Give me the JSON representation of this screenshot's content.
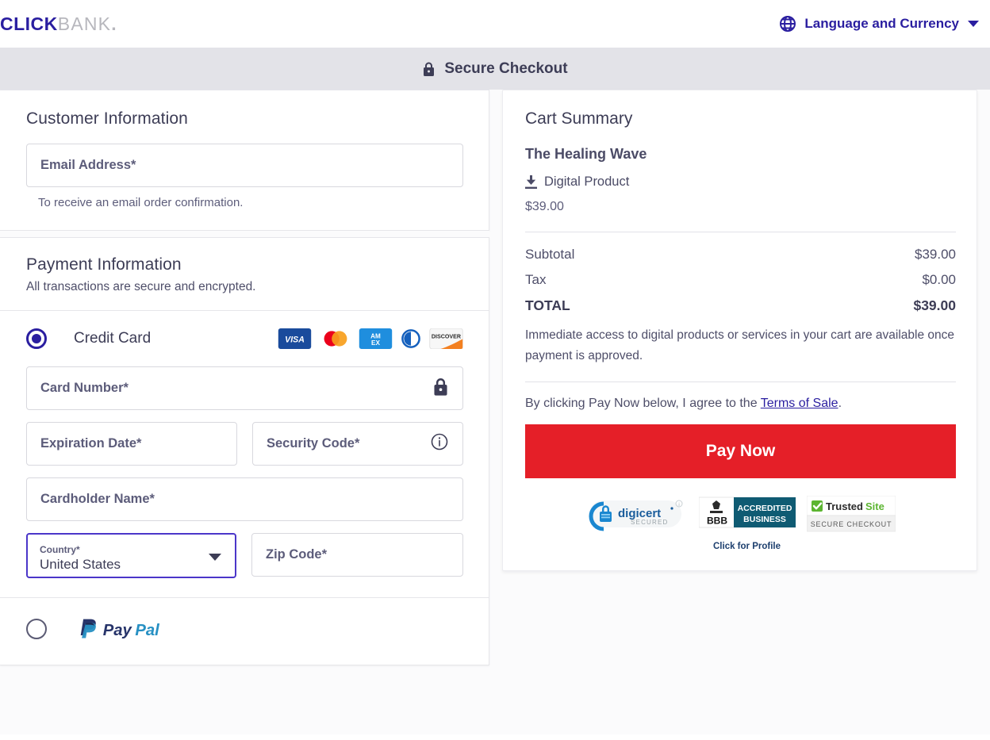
{
  "header": {
    "logo_primary": "CLICK",
    "logo_secondary": "BANK",
    "logo_dot": ".",
    "globe_icon": "globe-icon",
    "language_label": "Language and Currency",
    "chevron_icon": "chevron-down-icon"
  },
  "secure_bar": {
    "lock_icon": "lock-icon",
    "label": "Secure Checkout"
  },
  "customer": {
    "title": "Customer Information",
    "email_placeholder": "Email Address*",
    "helper": "To receive an email order confirmation."
  },
  "payment": {
    "title": "Payment Information",
    "subtitle": "All transactions are secure and encrypted.",
    "credit_card_label": "Credit Card",
    "card_brands": [
      "visa-logo",
      "mastercard-logo",
      "amex-logo",
      "diners-club-logo",
      "discover-logo"
    ],
    "card_number_placeholder": "Card Number*",
    "card_number_icon": "lock-icon",
    "expiration_placeholder": "Expiration Date*",
    "security_code_placeholder": "Security Code*",
    "security_code_icon": "info-icon",
    "cardholder_placeholder": "Cardholder Name*",
    "country_label": "Country*",
    "country_value": "United States",
    "country_caret_icon": "caret-down-icon",
    "zip_placeholder": "Zip Code*",
    "paypal_label": "PayPal"
  },
  "cart": {
    "title": "Cart Summary",
    "product_name": "The Healing Wave",
    "product_type": "Digital Product",
    "product_type_icon": "download-icon",
    "product_price": "$39.00",
    "lines": [
      {
        "label": "Subtotal",
        "value": "$39.00"
      },
      {
        "label": "Tax",
        "value": "$0.00"
      },
      {
        "label": "TOTAL",
        "value": "$39.00"
      }
    ],
    "note": "Immediate access to digital products or services in your cart are available once payment is approved.",
    "terms_prefix": "By clicking Pay Now below, I agree to the ",
    "terms_link": "Terms of Sale",
    "terms_suffix": ".",
    "pay_button": "Pay Now"
  },
  "badges": {
    "digicert_name": "digicert",
    "digicert_sub": "SECURED",
    "bbb_line1": "ACCREDITED",
    "bbb_line2": "BUSINESS",
    "bbb_mark": "BBB",
    "bbb_caption": "Click for Profile",
    "trusted_name_1": "Trusted",
    "trusted_name_2": "Site",
    "trusted_sub": "SECURE CHECKOUT"
  },
  "colors": {
    "brand_indigo": "#2a1ea0",
    "pay_red": "#e51f28",
    "text_slate": "#3d3d56",
    "bar_gray": "#e3e3e8"
  }
}
